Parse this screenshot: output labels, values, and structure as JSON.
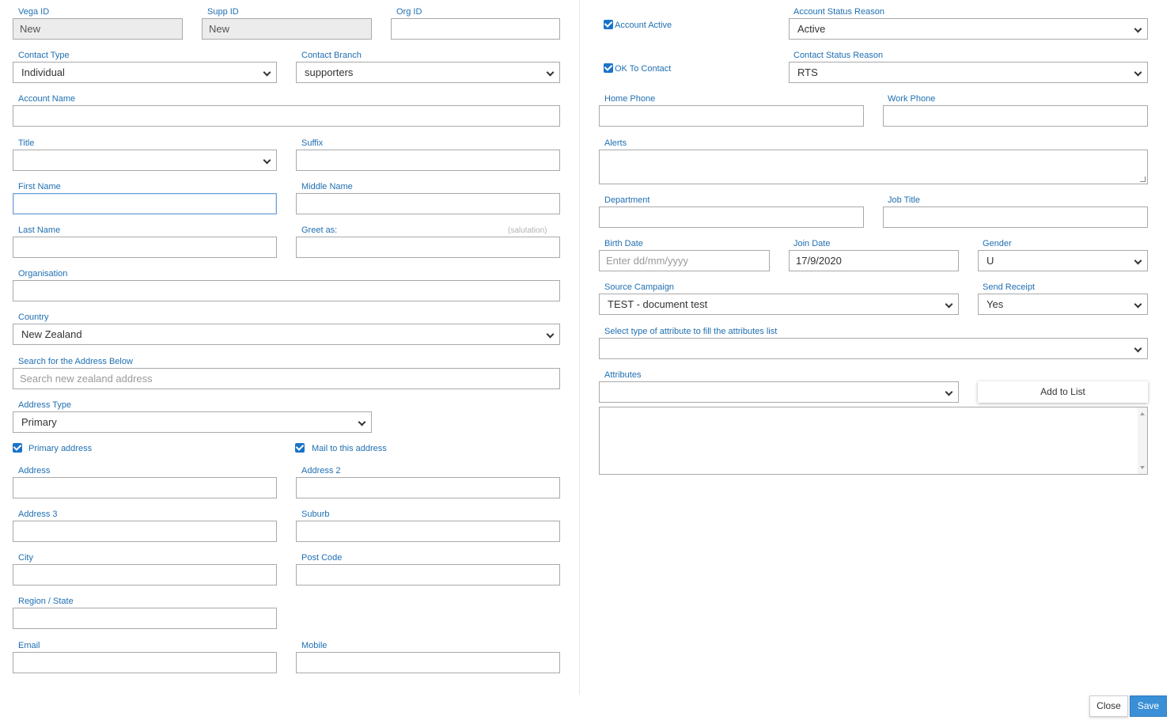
{
  "ids": {
    "vega_id_label": "Vega ID",
    "vega_id_value": "New",
    "supp_id_label": "Supp ID",
    "supp_id_value": "New",
    "org_id_label": "Org ID",
    "org_id_value": ""
  },
  "contact": {
    "type_label": "Contact Type",
    "type_value": "Individual",
    "branch_label": "Contact Branch",
    "branch_value": "supporters",
    "account_name_label": "Account Name",
    "account_name_value": "",
    "title_label": "Title",
    "title_value": "",
    "suffix_label": "Suffix",
    "suffix_value": "",
    "first_name_label": "First Name",
    "first_name_value": "",
    "middle_name_label": "Middle Name",
    "middle_name_value": "",
    "last_name_label": "Last Name",
    "last_name_value": "",
    "greet_as_label": "Greet as:",
    "greet_as_hint": "(salutation)",
    "greet_as_value": "",
    "organisation_label": "Organisation",
    "organisation_value": ""
  },
  "address": {
    "country_label": "Country",
    "country_value": "New Zealand",
    "search_label": "Search for the Address Below",
    "search_placeholder": "Search new zealand address",
    "type_label": "Address Type",
    "type_value": "Primary",
    "primary_label": "Primary address",
    "primary_checked": true,
    "mail_label": "Mail to this address",
    "mail_checked": true,
    "address_label": "Address",
    "address2_label": "Address 2",
    "address3_label": "Address 3",
    "suburb_label": "Suburb",
    "city_label": "City",
    "postcode_label": "Post Code",
    "region_label": "Region / State",
    "email_label": "Email",
    "mobile_label": "Mobile"
  },
  "status": {
    "account_active_label": "Account Active",
    "account_active_checked": true,
    "account_reason_label": "Account Status Reason",
    "account_reason_value": "Active",
    "ok_contact_label": "OK To Contact",
    "ok_contact_checked": true,
    "contact_reason_label": "Contact Status Reason",
    "contact_reason_value": "RTS"
  },
  "details": {
    "home_phone_label": "Home Phone",
    "work_phone_label": "Work Phone",
    "alerts_label": "Alerts",
    "department_label": "Department",
    "job_title_label": "Job Title",
    "birth_date_label": "Birth Date",
    "birth_date_placeholder": "Enter dd/mm/yyyy",
    "join_date_label": "Join Date",
    "join_date_value": "17/9/2020",
    "gender_label": "Gender",
    "gender_value": "U",
    "source_campaign_label": "Source Campaign",
    "source_campaign_value": "TEST - document test",
    "send_receipt_label": "Send Receipt",
    "send_receipt_value": "Yes",
    "attr_type_label": "Select type of attribute to fill the attributes list",
    "attr_type_value": "",
    "attributes_label": "Attributes",
    "attributes_value": "",
    "add_to_list_label": "Add to List"
  },
  "footer": {
    "close_label": "Close",
    "save_label": "Save"
  },
  "colors": {
    "label_blue": "#1f6fb2",
    "save_button": "#3a8fd6",
    "checkbox": "#1a73c9"
  },
  "icons": [
    "chevron-down-icon",
    "checkbox-checked-icon",
    "resize-grip-icon"
  ]
}
